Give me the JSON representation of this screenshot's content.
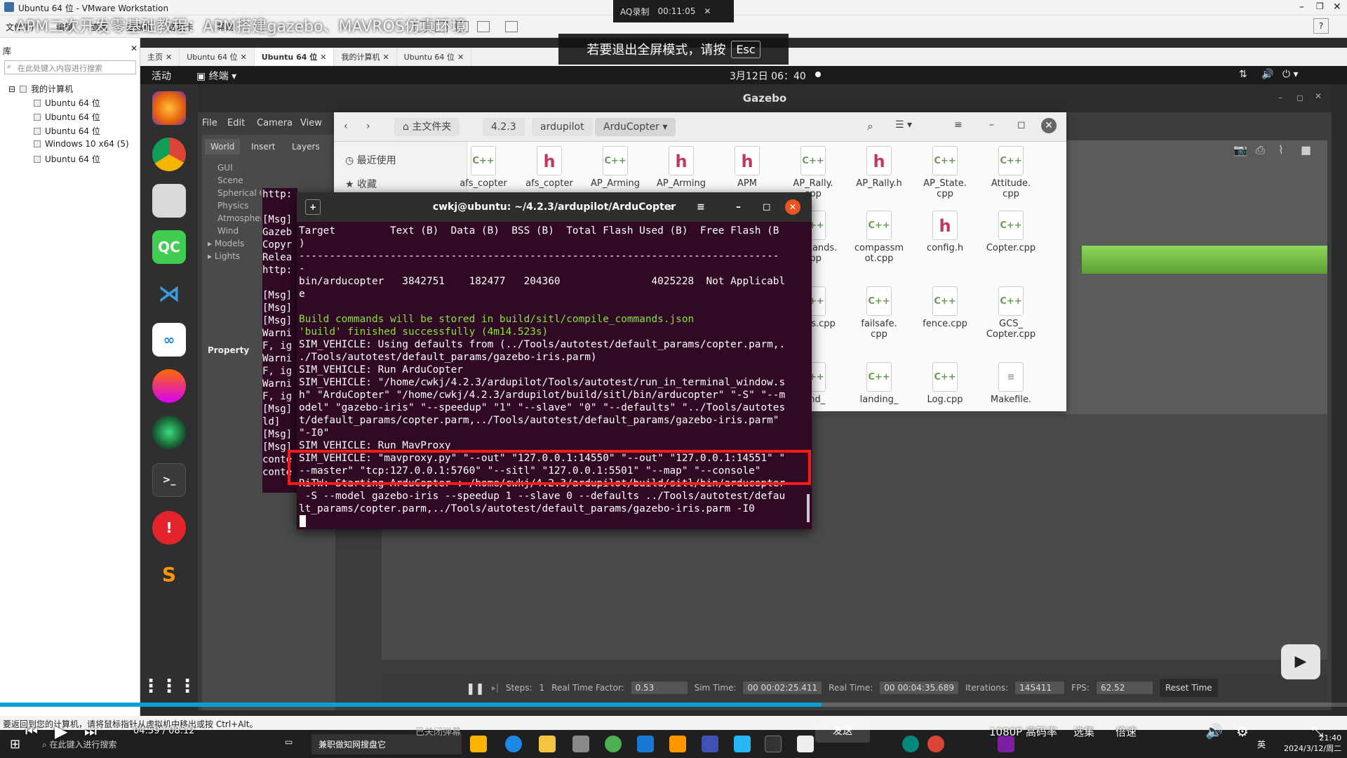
{
  "vmware": {
    "title": "Ubuntu 64 位 - VMware Workstation",
    "menu": [
      "文件(F)",
      "编辑",
      "查看",
      "虚拟机",
      "选项卡",
      "帮助"
    ],
    "library_label": "库",
    "search_placeholder": "在此处键入内容进行搜索",
    "tree_root": "我的计算机",
    "tree_items": [
      "Ubuntu 64 位",
      "Ubuntu 64 位",
      "Ubuntu 64 位",
      "Windows 10 x64 (5)",
      "Ubuntu 64 位"
    ],
    "tabs": [
      "主页",
      "Ubuntu 64 位",
      "Ubuntu 64 位",
      "我的计算机",
      "Ubuntu 64 位"
    ],
    "status_text": "要返回到您的计算机，请将鼠标指针从虚拟机中移出或按 Ctrl+Alt。"
  },
  "video_overlay": {
    "title": "APM二次开发零基础教程：APM搭建gazebo、MAVROS仿真环境",
    "esc_hint": "若要退出全屏模式，请按",
    "esc_key": "Esc",
    "recorder_label": "AQ录制",
    "recorder_time": "00:11:05",
    "player_time": "04:59 / 08:12",
    "player_send": "发送",
    "player_danmaku": "已关闭弹幕",
    "quality": "1080P 高码率",
    "episodes": "选集",
    "speed": "倍速",
    "progress_pct": 61
  },
  "ubuntu": {
    "activities": "活动",
    "terminal_app": "终端",
    "clock": "3月12日 06：40",
    "dock_icons": [
      "firefox-icon",
      "chrome-icon",
      "files-icon",
      "qt-creator-icon",
      "vscode-icon",
      "baidu-netdisk-icon",
      "fire-icon",
      "camera-icon",
      "terminal-icon",
      "help-icon",
      "sublime-icon",
      "apps-grid-icon"
    ]
  },
  "gazebo": {
    "title": "Gazebo",
    "menu": [
      "File",
      "Edit",
      "Camera",
      "View"
    ],
    "tabs": [
      "World",
      "Insert",
      "Layers"
    ],
    "tree": [
      "GUI",
      "Scene",
      "Spherical Coordinates",
      "Physics",
      "Atmosphere",
      "Wind",
      "Models",
      "Lights"
    ],
    "property_label": "Property",
    "bottom": {
      "steps_label": "Steps:",
      "steps": "1",
      "rtf_label": "Real Time Factor:",
      "rtf": "0.53",
      "sim_time_label": "Sim Time:",
      "sim_time": "00 00:02:25.411",
      "real_time_label": "Real Time:",
      "real_time": "00 00:04:35.689",
      "iterations_label": "Iterations:",
      "iterations": "145411",
      "fps_label": "FPS:",
      "fps": "62.52",
      "reset_label": "Reset Time"
    }
  },
  "files": {
    "breadcrumb": [
      "主文件夹",
      "4.2.3",
      "ardupilot",
      "ArduCopter"
    ],
    "sidebar": [
      "最近使用",
      "收藏"
    ],
    "items": [
      {
        "name": "afs_copter",
        "type": "cpp"
      },
      {
        "name": "afs_copter",
        "type": "h"
      },
      {
        "name": "AP_Arming",
        "type": "cpp"
      },
      {
        "name": "AP_Arming",
        "type": "h"
      },
      {
        "name": "APM",
        "type": "h"
      },
      {
        "name": "AP_Rally.\ncpp",
        "type": "cpp"
      },
      {
        "name": "AP_Rally.h",
        "type": "h"
      },
      {
        "name": "AP_State.\ncpp",
        "type": "cpp"
      },
      {
        "name": "Attitude.\ncpp",
        "type": "cpp"
      },
      {
        "name": "ommands.\ncpp",
        "type": "cpp"
      },
      {
        "name": "compassm\not.cpp",
        "type": "cpp"
      },
      {
        "name": "config.h",
        "type": "h"
      },
      {
        "name": "Copter.cpp",
        "type": "cpp"
      },
      {
        "name": "vents.cpp",
        "type": "cpp"
      },
      {
        "name": "failsafe.\ncpp",
        "type": "cpp"
      },
      {
        "name": "fence.cpp",
        "type": "cpp"
      },
      {
        "name": "GCS_\nCopter.cpp",
        "type": "cpp"
      },
      {
        "name": "land_",
        "type": "cpp"
      },
      {
        "name": "landing_",
        "type": "cpp"
      },
      {
        "name": "Log.cpp",
        "type": "cpp"
      },
      {
        "name": "Makefile.",
        "type": "txt"
      }
    ]
  },
  "terminal": {
    "title": "cwkj@ubuntu: ~/4.2.3/ardupilot/ArduCopter",
    "lines": [
      {
        "t": "Target         Text (B)  Data (B)  BSS (B)  Total Flash Used (B)  Free Flash (B",
        "c": ""
      },
      {
        "t": ")",
        "c": ""
      },
      {
        "t": "-------------------------------------------------------------------------------",
        "c": ""
      },
      {
        "t": "-",
        "c": ""
      },
      {
        "t": "bin/arducopter   3842751    182477   204360               4025228  Not Applicabl",
        "c": ""
      },
      {
        "t": "e",
        "c": ""
      },
      {
        "t": "",
        "c": ""
      },
      {
        "t": "Build commands will be stored in build/sitl/compile_commands.json",
        "c": "green"
      },
      {
        "t": "'build' finished successfully (4m14.523s)",
        "c": "green"
      },
      {
        "t": "SIM_VEHICLE: Using defaults from (../Tools/autotest/default_params/copter.parm,.",
        "c": ""
      },
      {
        "t": "./Tools/autotest/default_params/gazebo-iris.parm)",
        "c": ""
      },
      {
        "t": "SIM_VEHICLE: Run ArduCopter",
        "c": ""
      },
      {
        "t": "SIM_VEHICLE: \"/home/cwkj/4.2.3/ardupilot/Tools/autotest/run_in_terminal_window.s",
        "c": ""
      },
      {
        "t": "h\" \"ArduCopter\" \"/home/cwkj/4.2.3/ardupilot/build/sitl/bin/arducopter\" \"-S\" \"--m",
        "c": ""
      },
      {
        "t": "odel\" \"gazebo-iris\" \"--speedup\" \"1\" \"--slave\" \"0\" \"--defaults\" \"../Tools/autotes",
        "c": ""
      },
      {
        "t": "t/default_params/copter.parm,../Tools/autotest/default_params/gazebo-iris.parm\"",
        "c": ""
      },
      {
        "t": "\"-I0\"",
        "c": ""
      },
      {
        "t": "SIM_VEHICLE: Run MavProxy",
        "c": ""
      },
      {
        "t": "SIM_VEHICLE: \"mavproxy.py\" \"--out\" \"127.0.0.1:14550\" \"--out\" \"127.0.0.1:14551\" \"",
        "c": ""
      },
      {
        "t": "--master\" \"tcp:127.0.0.1:5760\" \"--sitl\" \"127.0.0.1:5501\" \"--map\" \"--console\"",
        "c": ""
      },
      {
        "t": "RiTW: Starting ArduCopter : /home/cwkj/4.2.3/ardupilot/build/sitl/bin/arducopter",
        "c": ""
      },
      {
        "t": " -S --model gazebo-iris --speedup 1 --slave 0 --defaults ../Tools/autotest/defau",
        "c": ""
      },
      {
        "t": "lt_params/copter.parm,../Tools/autotest/default_params/gazebo-iris.parm -I0",
        "c": ""
      }
    ]
  },
  "term2_lines": [
    "http:",
    "",
    "[Msg]",
    "Gazeb",
    "Copyr",
    "Relea",
    "http:",
    "",
    "[Msg]",
    "[Msg]",
    "[Msg]",
    "Warni",
    "F, ig",
    "Warni",
    "F, ig",
    "Warni",
    "F, ig",
    "[Msg]",
    "ld]",
    "[Msg]",
    "[Msg]",
    "conte",
    "conte"
  ],
  "taskbar": {
    "search": "在此键入进行搜索",
    "pinned_app": "兼职做知网搜盘它",
    "clock_time": "21:40",
    "clock_date": "2024/3/12/周二",
    "ime": "英"
  }
}
